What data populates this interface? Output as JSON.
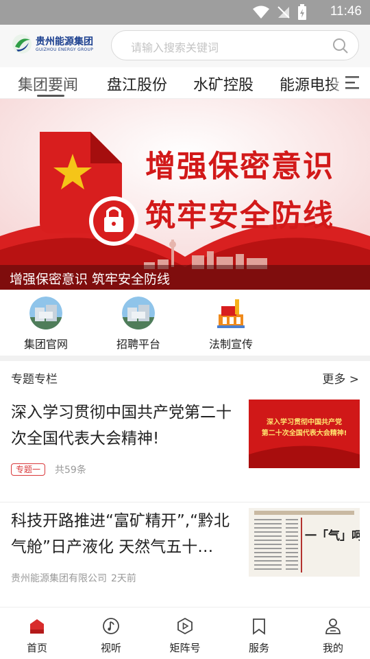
{
  "status_bar": {
    "time": "11:46"
  },
  "header": {
    "logo_cn": "贵州能源集团",
    "logo_en": "GUIZHOU ENERGY GROUP",
    "search_placeholder": "请输入搜索关键词"
  },
  "tabs": [
    {
      "label": "集团要闻",
      "active": true
    },
    {
      "label": "盘江股份",
      "active": false
    },
    {
      "label": "水矿控股",
      "active": false
    },
    {
      "label": "能源电投",
      "active": false
    }
  ],
  "banner": {
    "title_line1": "增强保密意识",
    "title_line2": "筑牢安全防线",
    "caption": "增强保密意识 筑牢安全防线"
  },
  "quick_links": [
    {
      "label": "集团官网",
      "icon": "building-photo-icon"
    },
    {
      "label": "招聘平台",
      "icon": "building-photo-icon"
    },
    {
      "label": "法制宣传",
      "icon": "law-building-icon"
    }
  ],
  "section": {
    "title": "专题专栏",
    "more": "更多 >"
  },
  "cards": [
    {
      "title": "深入学习贯彻中国共产党第二十次全国代表大会精神!",
      "tag": "专题一",
      "meta": "共59条",
      "thumb_line1": "深入学习贯彻中国共产党",
      "thumb_line2": "第二十次全国代表大会精神!"
    },
    {
      "title": "科技开路推进“富矿精开”,“黔北气舱”日产液化 天然气五十…",
      "source": "贵州能源集团有限公司",
      "time": "2天前",
      "thumb_big": "一「气」呵成看"
    }
  ],
  "bottom_nav": [
    {
      "label": "首页",
      "icon": "home-icon",
      "active": true
    },
    {
      "label": "视听",
      "icon": "music-note-icon",
      "active": false
    },
    {
      "label": "矩阵号",
      "icon": "play-hexagon-icon",
      "active": false
    },
    {
      "label": "服务",
      "icon": "bookmark-icon",
      "active": false
    },
    {
      "label": "我的",
      "icon": "profile-icon",
      "active": false
    }
  ],
  "colors": {
    "brand_red": "#d21919",
    "status_bar": "#9e9e9e",
    "logo_blue": "#1b3f8f"
  }
}
